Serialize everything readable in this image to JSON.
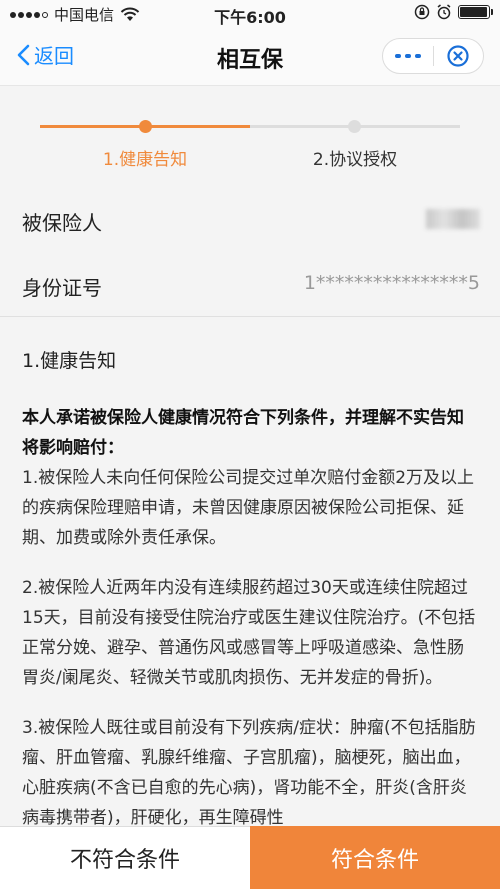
{
  "status_bar": {
    "carrier": "中国电信",
    "time": "下午6:00",
    "battery_level": 0.95
  },
  "nav": {
    "back_label": "返回",
    "title": "相互保",
    "icons": [
      "chevron-left-icon",
      "more-icon",
      "close-circle-icon"
    ]
  },
  "steps": [
    {
      "label": "1.健康告知",
      "active": true
    },
    {
      "label": "2.协议授权",
      "active": false
    }
  ],
  "info": {
    "insured_label": "被保险人",
    "id_label": "身份证号",
    "id_value": "1****************5"
  },
  "health": {
    "title": "1.健康告知",
    "intro": "本人承诺被保险人健康情况符合下列条件，并理解不实告知将影响赔付：",
    "items": [
      "1.被保险人未向任何保险公司提交过单次赔付金额2万及以上的疾病保险理赔申请，未曾因健康原因被保险公司拒保、延期、加费或除外责任承保。",
      "2.被保险人近两年内没有连续服药超过30天或连续住院超过15天，目前没有接受住院治疗或医生建议住院治疗。(不包括正常分娩、避孕、普通伤风或感冒等上呼吸道感染、急性肠胃炎/阑尾炎、轻微关节或肌肉损伤、无并发症的骨折)。",
      "3.被保险人既往或目前没有下列疾病/症状：肿瘤(不包括脂肪瘤、肝血管瘤、乳腺纤维瘤、子宫肌瘤)，脑梗死，脑出血，心脏疾病(不含已自愈的先心病)，肾功能不全，肝炎(含肝炎病毒携带者)，肝硬化，再生障碍性"
    ]
  },
  "footer": {
    "reject_label": "不符合条件",
    "accept_label": "符合条件"
  },
  "colors": {
    "accent": "#f08a3c",
    "link": "#1a8cff"
  }
}
